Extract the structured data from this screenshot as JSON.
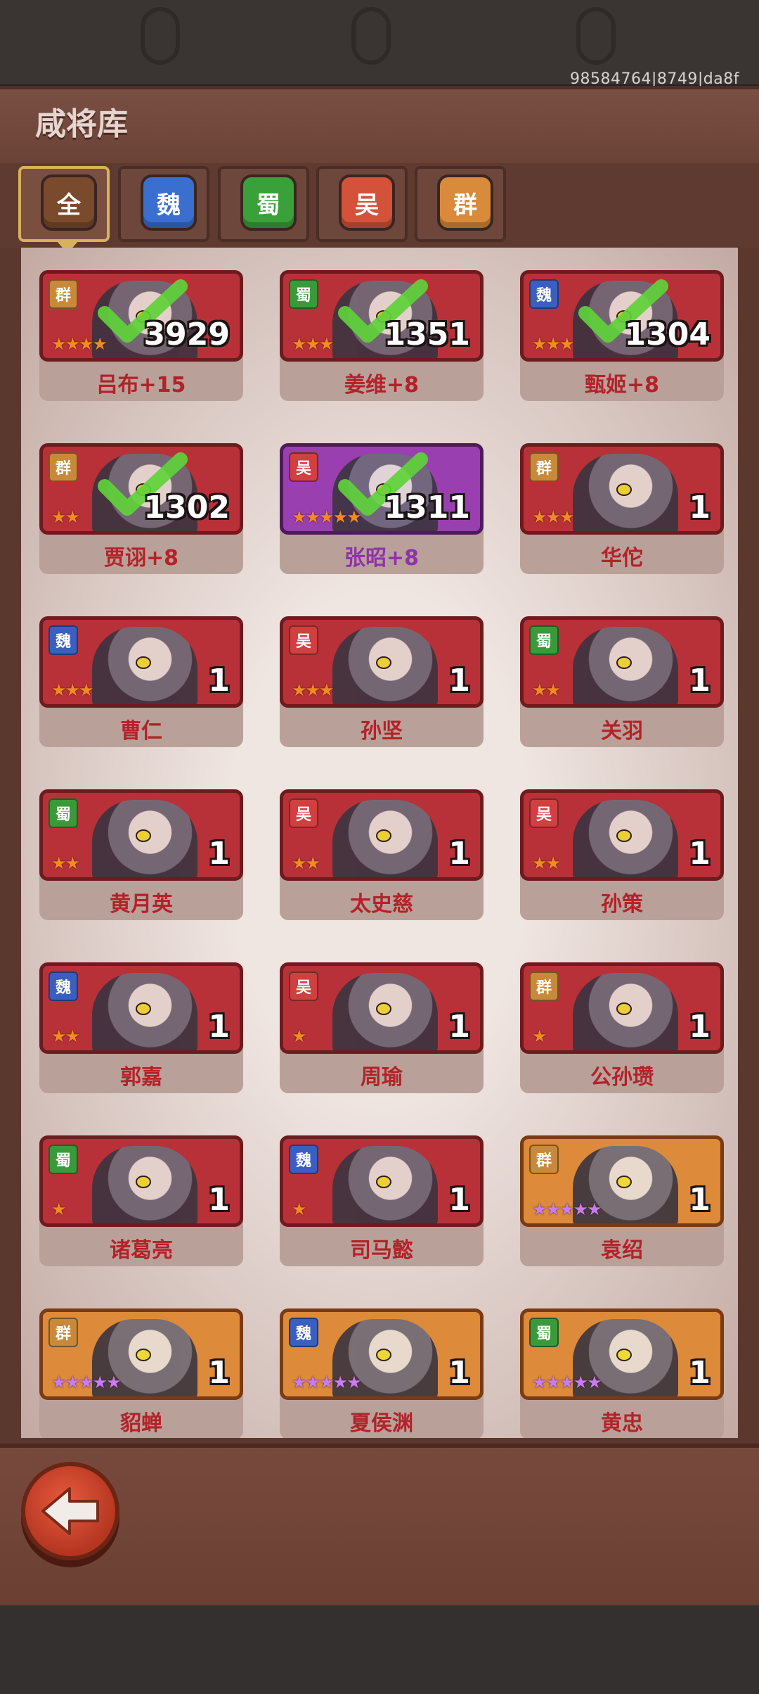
{
  "status": {
    "session_id": "98584764|8749|da8f"
  },
  "header": {
    "title": "咸将库"
  },
  "tabs": [
    {
      "label": "全",
      "color": "#7a4a2c",
      "active": true
    },
    {
      "label": "魏",
      "color": "#3a6fd0",
      "active": false
    },
    {
      "label": "蜀",
      "color": "#3aa13a",
      "active": false
    },
    {
      "label": "吴",
      "color": "#d4523a",
      "active": false
    },
    {
      "label": "群",
      "color": "#d98a3a",
      "active": false
    }
  ],
  "heroes": [
    {
      "name": "吕布+15",
      "faction": "群",
      "count": "3929",
      "stars": 4,
      "star_color": "gold",
      "frame": "red",
      "owned": true
    },
    {
      "name": "姜维+8",
      "faction": "蜀",
      "count": "1351",
      "stars": 3,
      "star_color": "gold",
      "frame": "red",
      "owned": true
    },
    {
      "name": "甄姬+8",
      "faction": "魏",
      "count": "1304",
      "stars": 3,
      "star_color": "gold",
      "frame": "red",
      "owned": true
    },
    {
      "name": "贾诩+8",
      "faction": "群",
      "count": "1302",
      "stars": 2,
      "star_color": "gold",
      "frame": "red",
      "owned": true
    },
    {
      "name": "张昭+8",
      "faction": "吴",
      "count": "1311",
      "stars": 5,
      "star_color": "gold",
      "frame": "purple",
      "owned": true
    },
    {
      "name": "华佗",
      "faction": "群",
      "count": "1",
      "stars": 3,
      "star_color": "gold",
      "frame": "red",
      "owned": false
    },
    {
      "name": "曹仁",
      "faction": "魏",
      "count": "1",
      "stars": 3,
      "star_color": "gold",
      "frame": "red",
      "owned": false
    },
    {
      "name": "孙坚",
      "faction": "吴",
      "count": "1",
      "stars": 3,
      "star_color": "gold",
      "frame": "red",
      "owned": false
    },
    {
      "name": "关羽",
      "faction": "蜀",
      "count": "1",
      "stars": 2,
      "star_color": "gold",
      "frame": "red",
      "owned": false
    },
    {
      "name": "黄月英",
      "faction": "蜀",
      "count": "1",
      "stars": 2,
      "star_color": "gold",
      "frame": "red",
      "owned": false
    },
    {
      "name": "太史慈",
      "faction": "吴",
      "count": "1",
      "stars": 2,
      "star_color": "gold",
      "frame": "red",
      "owned": false
    },
    {
      "name": "孙策",
      "faction": "吴",
      "count": "1",
      "stars": 2,
      "star_color": "gold",
      "frame": "red",
      "owned": false
    },
    {
      "name": "郭嘉",
      "faction": "魏",
      "count": "1",
      "stars": 2,
      "star_color": "gold",
      "frame": "red",
      "owned": false
    },
    {
      "name": "周瑜",
      "faction": "吴",
      "count": "1",
      "stars": 1,
      "star_color": "gold",
      "frame": "red",
      "owned": false
    },
    {
      "name": "公孙瓒",
      "faction": "群",
      "count": "1",
      "stars": 1,
      "star_color": "gold",
      "frame": "red",
      "owned": false
    },
    {
      "name": "诸葛亮",
      "faction": "蜀",
      "count": "1",
      "stars": 1,
      "star_color": "gold",
      "frame": "red",
      "owned": false
    },
    {
      "name": "司马懿",
      "faction": "魏",
      "count": "1",
      "stars": 1,
      "star_color": "gold",
      "frame": "red",
      "owned": false
    },
    {
      "name": "袁绍",
      "faction": "群",
      "count": "1",
      "stars": 5,
      "star_color": "violet",
      "frame": "orange",
      "owned": false
    },
    {
      "name": "貂蝉",
      "faction": "群",
      "count": "1",
      "stars": 5,
      "star_color": "violet",
      "frame": "orange",
      "owned": false
    },
    {
      "name": "夏侯渊",
      "faction": "魏",
      "count": "1",
      "stars": 5,
      "star_color": "violet",
      "frame": "orange",
      "owned": false
    },
    {
      "name": "黄忠",
      "faction": "蜀",
      "count": "1",
      "stars": 5,
      "star_color": "violet",
      "frame": "orange",
      "owned": false
    }
  ],
  "faction_colors": {
    "群": "#c88a3a",
    "蜀": "#3a9a3a",
    "魏": "#3a5fc0",
    "吴": "#d04040"
  },
  "icons": {
    "back": "back-arrow-icon",
    "check": "check-mark-icon"
  }
}
